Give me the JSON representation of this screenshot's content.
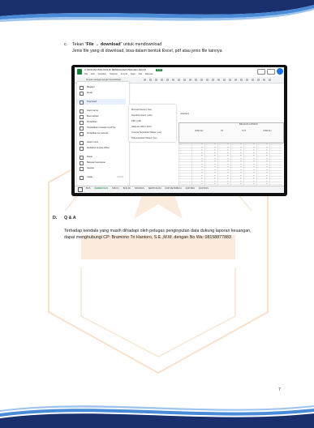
{
  "step": {
    "marker": "c.",
    "prefix": "Tekan \"",
    "bold": "File → download",
    "suffix": "\" untuk mendownload",
    "line2": "Jenis file yang di download, bisa dalam bentuk Excel, pdf atau jenis file lainnya"
  },
  "screenshot": {
    "doc_title": "2. RINCIAN BSA KAS DI BENDAHARA PENGELUARAN",
    "badge": "XLSX",
    "menu_bar": [
      "File",
      "Edit",
      "Tampilan",
      "Sisipkan",
      "Format",
      "Data",
      "Alat",
      "Bantuan"
    ],
    "search_placeholder": "Simpan sebagai Google Spreadsheet",
    "file_menu": [
      {
        "label": "Bagikan",
        "icon": "share-icon"
      },
      {
        "label": "Email",
        "icon": "mail-icon"
      },
      {
        "label": "Download",
        "icon": "download-icon"
      },
      {
        "label": "Ganti nama",
        "icon": "edit-icon"
      },
      {
        "label": "Buat salinan",
        "icon": "copy-icon"
      },
      {
        "label": "Pindahkan",
        "icon": "folder-icon"
      },
      {
        "label": "Tambahkan pintasan ke Drive",
        "icon": "drive-icon"
      },
      {
        "label": "Pindahkan ke sampah",
        "icon": "trash-icon"
      },
      {
        "label": "Histori versi",
        "icon": "history-icon"
      },
      {
        "label": "Sediakan secara offline",
        "icon": "offline-icon"
      },
      {
        "label": "Detail",
        "icon": "info-icon"
      },
      {
        "label": "Batasan keamanan",
        "icon": "lock-icon"
      },
      {
        "label": "Setelan",
        "icon": "gear-icon"
      },
      {
        "label": "Cetak",
        "icon": "print-icon",
        "shortcut": "Ctrl+P"
      }
    ],
    "download_submenu": [
      "Microsoft Excel (.xlsx)",
      "OpenDocument (.ods)",
      "PDF (.pdf)",
      "Halaman Web (.html)",
      "Comma Separated Values (.csv)",
      "Tab-separated Values (.tsv)"
    ],
    "sheet_title": "ndahara",
    "col_header": "BELANJA LAINNYA",
    "col_labels": [
      "JUMLAH",
      "ST",
      "TGT",
      "JUMLAH"
    ],
    "sheet_tabs": [
      "BOS",
      "PEMBIAYAAN",
      "SPM KI",
      "BOS MI",
      "SPM BOS",
      "SERTIFIKASI",
      "DOP RETRIBUSI",
      "DOP BKK",
      "DOP BOS"
    ]
  },
  "section": {
    "marker": "D.",
    "title": "Q & A",
    "para_line1": "Terhadap kendala yang masih dihadapi oleh petugas penginputan data dukung laporan keuangan,",
    "para_line2": "dapat menghubungi CP: Bramono Tri Hantoro, S.E.,M.M. dengan No Wa: 08158877883"
  },
  "page_number": "7",
  "colors": {
    "wave_dark": "#1a2f6e",
    "wave_light": "#4a8bd8",
    "watermark": "#f2c79a",
    "sheets_green": "#188038",
    "highlight": "#e8f0fe"
  }
}
